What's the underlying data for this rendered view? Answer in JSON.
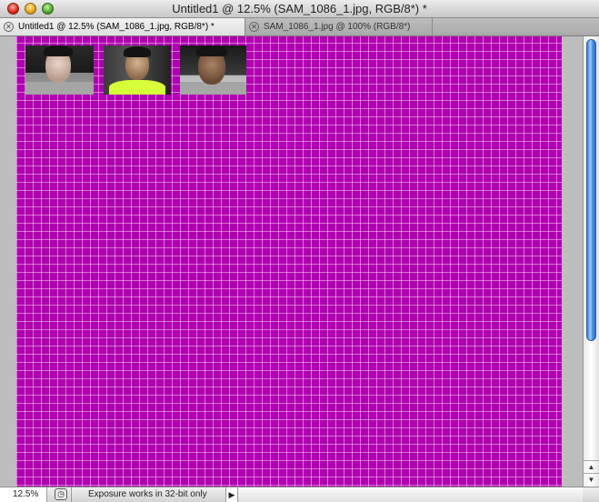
{
  "window": {
    "title": "Untitled1 @ 12.5% (SAM_1086_1.jpg, RGB/8*) *"
  },
  "tabs": [
    {
      "label": "Untitled1 @ 12.5% (SAM_1086_1.jpg, RGB/8*) *",
      "active": true
    },
    {
      "label": "SAM_1086_1.jpg @ 100% (RGB/8*)",
      "active": false
    }
  ],
  "tab_close_glyph": "✕",
  "canvas": {
    "background_color": "#b000b0",
    "grid_color": "#ffffff",
    "photos": [
      {
        "name": "photo-person-1"
      },
      {
        "name": "photo-person-2"
      },
      {
        "name": "photo-person-3"
      }
    ]
  },
  "scrollbar": {
    "up_glyph": "▲",
    "down_glyph": "▼"
  },
  "status": {
    "zoom": "12.5%",
    "icon_glyph": "◷",
    "message": "Exposure works in 32-bit only",
    "arrow_glyph": "▶"
  }
}
